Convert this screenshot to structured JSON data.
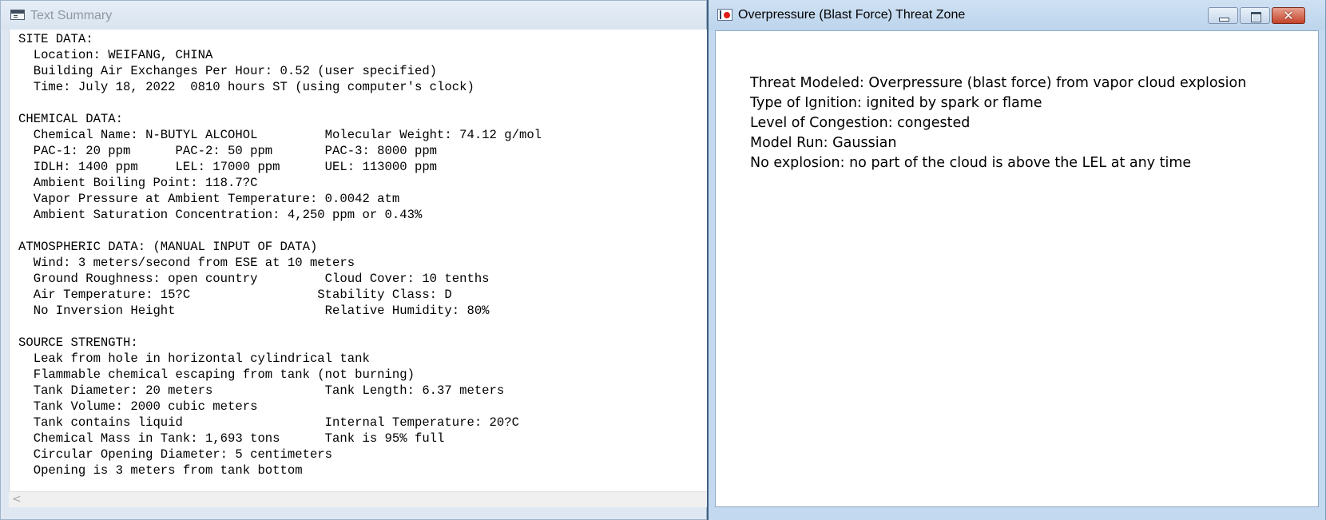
{
  "text_summary_window": {
    "title": "Text Summary",
    "icon": "text-window-icon",
    "lines": [
      "SITE DATA:",
      "  Location: WEIFANG, CHINA",
      "  Building Air Exchanges Per Hour: 0.52 (user specified)",
      "  Time: July 18, 2022  0810 hours ST (using computer's clock)",
      "",
      "CHEMICAL DATA:",
      "  Chemical Name: N-BUTYL ALCOHOL         Molecular Weight: 74.12 g/mol",
      "  PAC-1: 20 ppm      PAC-2: 50 ppm       PAC-3: 8000 ppm",
      "  IDLH: 1400 ppm     LEL: 17000 ppm      UEL: 113000 ppm",
      "  Ambient Boiling Point: 118.7?C",
      "  Vapor Pressure at Ambient Temperature: 0.0042 atm",
      "  Ambient Saturation Concentration: 4,250 ppm or 0.43%",
      "",
      "ATMOSPHERIC DATA: (MANUAL INPUT OF DATA)",
      "  Wind: 3 meters/second from ESE at 10 meters",
      "  Ground Roughness: open country         Cloud Cover: 10 tenths",
      "  Air Temperature: 15?C                 Stability Class: D",
      "  No Inversion Height                    Relative Humidity: 80%",
      "",
      "SOURCE STRENGTH:",
      "  Leak from hole in horizontal cylindrical tank",
      "  Flammable chemical escaping from tank (not burning)",
      "  Tank Diameter: 20 meters               Tank Length: 6.37 meters",
      "  Tank Volume: 2000 cubic meters",
      "  Tank contains liquid                   Internal Temperature: 20?C",
      "  Chemical Mass in Tank: 1,693 tons      Tank is 95% full",
      "  Circular Opening Diameter: 5 centimeters",
      "  Opening is 3 meters from tank bottom"
    ],
    "scroll_left_glyph": "<"
  },
  "threat_window": {
    "title": "Overpressure (Blast Force) Threat Zone",
    "icon": "threat-zone-icon",
    "controls": {
      "minimize_icon": "minimize-icon",
      "maximize_icon": "maximize-icon",
      "close_glyph": "✕"
    },
    "lines": [
      "Threat Modeled: Overpressure (blast force) from vapor cloud explosion",
      "Type of Ignition: ignited by spark or flame",
      "Level of Congestion: congested",
      "Model Run: Gaussian",
      "No explosion: no part of the cloud is above the LEL at any time"
    ]
  }
}
